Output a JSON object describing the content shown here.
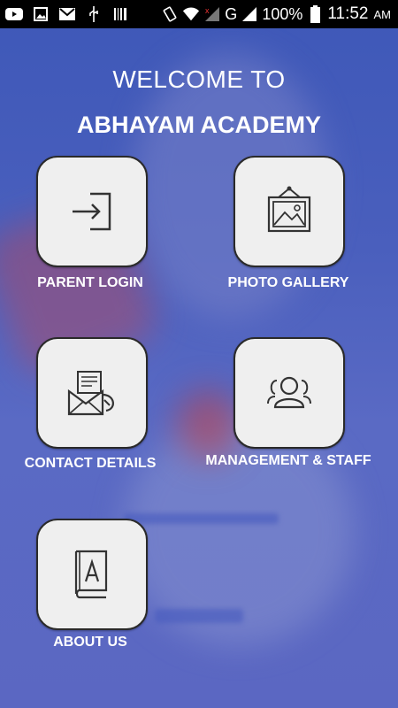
{
  "status_bar": {
    "battery": "100%",
    "time": "11:52",
    "ampm": "AM",
    "network": "G",
    "icons": [
      "youtube-icon",
      "gallery-icon",
      "gmail-icon",
      "usb-icon",
      "barcode-icon",
      "vibrate-icon",
      "wifi-icon",
      "signal-icon",
      "signal-icon",
      "battery-icon"
    ]
  },
  "header": {
    "welcome": "WELCOME TO",
    "school": "ABHAYAM ACADEMY"
  },
  "menu": [
    {
      "label": "PARENT LOGIN",
      "icon": "login-icon"
    },
    {
      "label": "PHOTO GALLERY",
      "icon": "picture-frame-icon"
    },
    {
      "label": "CONTACT DETAILS",
      "icon": "contact-mail-icon"
    },
    {
      "label": "MANAGEMENT & STAFF",
      "icon": "people-icon"
    },
    {
      "label": "ABOUT US",
      "icon": "book-icon"
    }
  ],
  "colors": {
    "background": "#4a5fbd",
    "tile": "#efefef",
    "text": "#ffffff"
  }
}
